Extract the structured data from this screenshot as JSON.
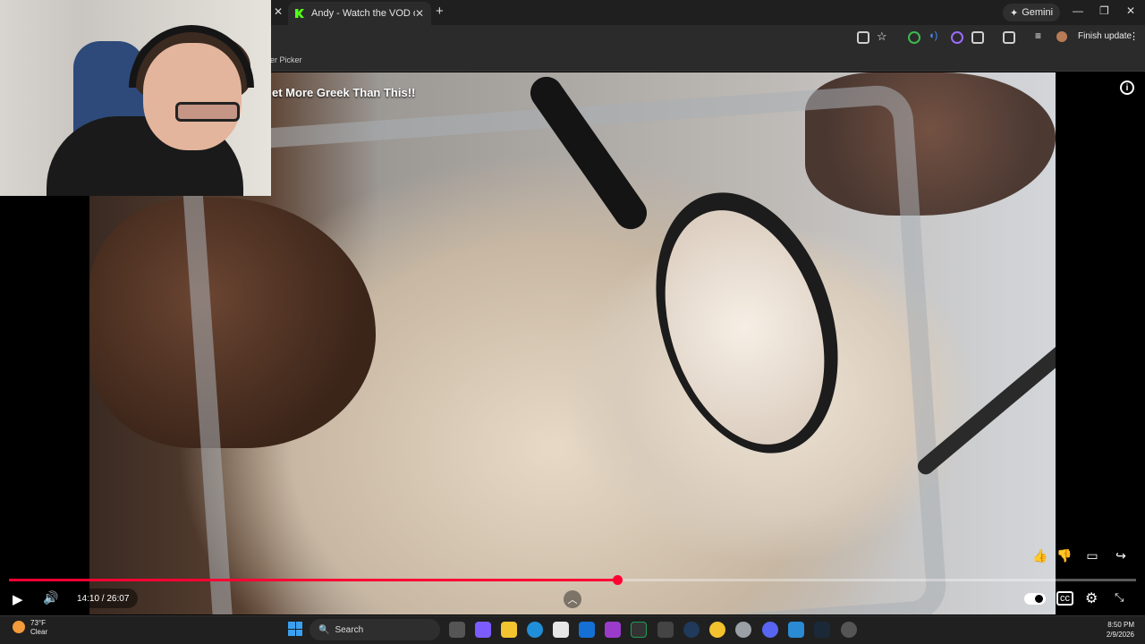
{
  "browser": {
    "tab_title": "Andy - Watch the VOD on Kick",
    "gemini_label": "Gemini",
    "finish_update_label": "Finish update",
    "bookmark_text": "er Picker"
  },
  "video": {
    "title": "et More Greek Than This!!",
    "current_time": "14:10",
    "duration": "26:07",
    "time_display": "14:10 / 26:07",
    "progress": 0.54
  },
  "taskbar": {
    "weather_temp": "73°F",
    "weather_desc": "Clear",
    "search_label": "Search",
    "time": "8:50 PM",
    "date": "2/9/2026"
  },
  "colors": {
    "progress": "#ff0033",
    "accent": "#53fc18"
  }
}
